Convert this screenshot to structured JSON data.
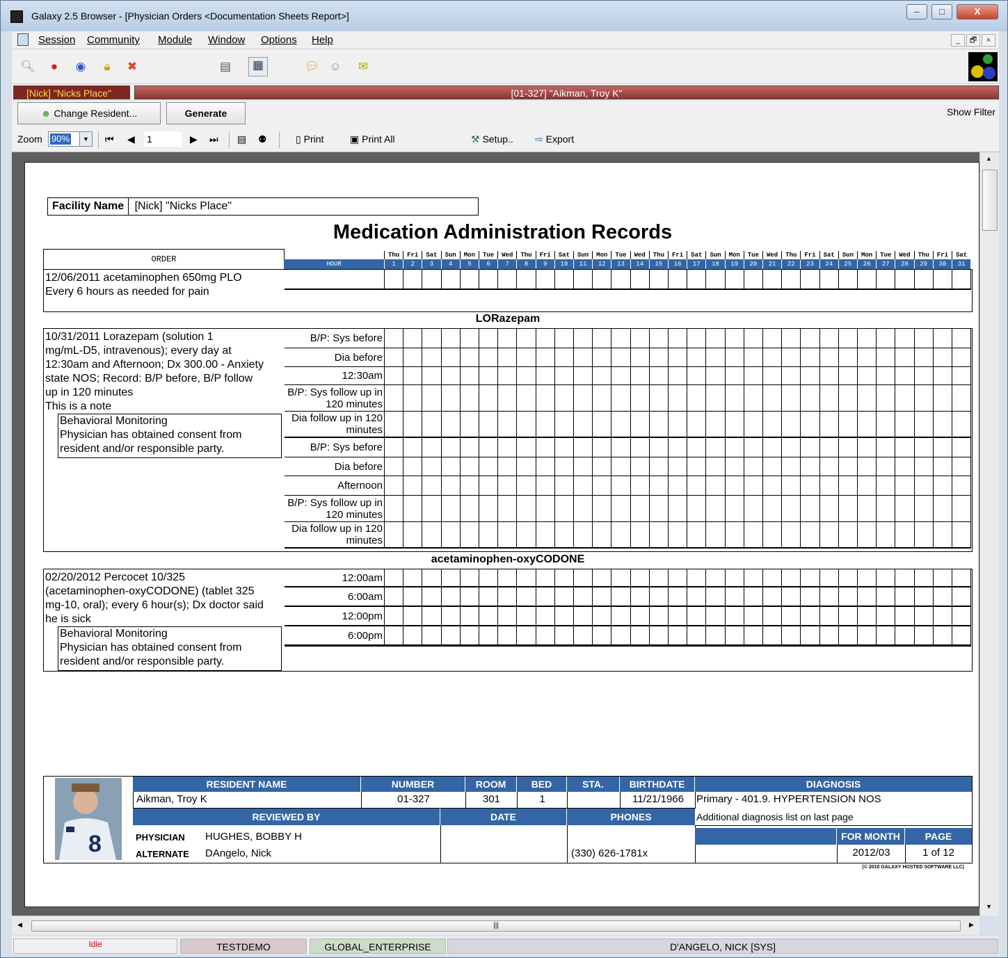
{
  "window": {
    "title": "Galaxy 2.5 Browser - [Physician Orders  <Documentation Sheets Report>]",
    "controls": [
      "–",
      "□",
      "X"
    ]
  },
  "menu": {
    "items": [
      "Session",
      "Community",
      "Module",
      "Window",
      "Options",
      "Help"
    ],
    "mdi_controls": [
      "_",
      "🗗",
      "×"
    ]
  },
  "statusband": {
    "facility": "[Nick] \"Nicks Place\"",
    "resident": "[01-327] \"Aikman, Troy K\""
  },
  "commands": {
    "change_resident": "Change Resident...",
    "generate": "Generate",
    "show_filter": "Show Filter"
  },
  "report_toolbar": {
    "zoom_label": "Zoom",
    "zoom_value": "90%",
    "page_value": "1",
    "print": "Print",
    "print_all": "Print All",
    "setup": "Setup..",
    "export": "Export"
  },
  "report": {
    "facility_label": "Facility Name",
    "facility_value": "[Nick] \"Nicks Place\"",
    "title": "Medication Administration Records",
    "order_header": "ORDER",
    "hour_header": "HOUR",
    "weekdays": [
      "Thu",
      "Fri",
      "Sat",
      "Sun",
      "Mon",
      "Tue",
      "Wed",
      "Thu",
      "Fri",
      "Sat",
      "Sun",
      "Mon",
      "Tue",
      "Wed",
      "Thu",
      "Fri",
      "Sat",
      "Sun",
      "Mon",
      "Tue",
      "Wed",
      "Thu",
      "Fri",
      "Sat",
      "Sun",
      "Mon",
      "Tue",
      "Wed",
      "Thu",
      "Fri",
      "Sat"
    ],
    "days": [
      "1",
      "2",
      "3",
      "4",
      "5",
      "6",
      "7",
      "8",
      "9",
      "10",
      "11",
      "12",
      "13",
      "14",
      "15",
      "16",
      "17",
      "18",
      "19",
      "20",
      "21",
      "22",
      "23",
      "24",
      "25",
      "26",
      "27",
      "28",
      "29",
      "30",
      "31"
    ],
    "order1": {
      "lines": [
        "12/06/2011 acetaminophen 650mg PLO",
        "Every 6 hours as needed for pain"
      ]
    },
    "drug2": "LORazepam",
    "order2": {
      "lines": [
        "10/31/2011 Lorazepam (solution 1",
        "mg/mL-D5, intravenous); every day at",
        "12:30am and Afternoon; Dx 300.00 - Anxiety",
        "state NOS; Record: B/P before, B/P follow",
        "up in 120 minutes",
        "This is a note"
      ],
      "bm_lines": [
        "Behavioral Monitoring",
        "Physician has obtained consent from",
        "resident and/or responsible party."
      ],
      "hours": [
        "B/P: Sys before",
        "Dia before",
        "12:30am",
        "B/P: Sys follow up in 120 minutes",
        "Dia follow up in 120 minutes",
        "B/P: Sys before",
        "Dia before",
        "Afternoon",
        "B/P: Sys follow up in 120 minutes",
        "Dia follow up in 120 minutes"
      ]
    },
    "drug3": "acetaminophen-oxyCODONE",
    "order3": {
      "lines": [
        "02/20/2012 Percocet 10/325",
        "(acetaminophen-oxyCODONE) (tablet 325",
        "mg-10, oral); every 6 hour(s); Dx doctor said",
        "he is sick"
      ],
      "bm_lines": [
        "Behavioral Monitoring",
        "Physician has obtained consent from",
        "resident and/or responsible party."
      ],
      "hours": [
        "12:00am",
        "6:00am",
        "12:00pm",
        "6:00pm"
      ]
    },
    "footer": {
      "h_resident_name": "RESIDENT NAME",
      "h_number": "NUMBER",
      "h_room": "ROOM",
      "h_bed": "BED",
      "h_sta": "STA.",
      "h_birthdate": "BIRTHDATE",
      "h_diagnosis": "DIAGNOSIS",
      "resident_name": "Aikman, Troy K",
      "number": "01-327",
      "room": "301",
      "bed": "1",
      "sta": "",
      "birthdate": "11/21/1966",
      "diagnosis_primary": "Primary - 401.9. HYPERTENSION NOS",
      "diagnosis_additional": "Additional diagnosis list on last page",
      "h_reviewed_by": "REVIEWED BY",
      "h_date": "DATE",
      "h_phones": "PHONES",
      "physician_label": "PHYSICIAN",
      "physician": "HUGHES, BOBBY H",
      "alternate_label": "ALTERNATE",
      "alternate": "DAngelo, Nick",
      "phone": "(330) 626-1781x",
      "h_for_month": "FOR MONTH",
      "h_page": "PAGE",
      "for_month": "2012/03",
      "page": "1 of 12",
      "copyright": "(© 2010 GALAXY HOSTED SOFTWARE LLC)"
    }
  },
  "statusbar": {
    "state": "Idle",
    "db": "TESTDEMO",
    "enterprise": "GLOBAL_ENTERPRISE",
    "user": "D'ANGELO, NICK [SYS]"
  }
}
